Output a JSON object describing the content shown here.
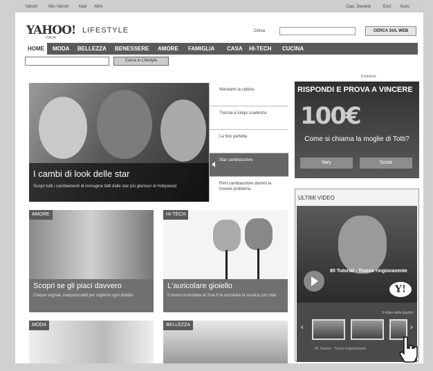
{
  "topbar": {
    "links": [
      "Yahoo!",
      "Mio Yahoo!",
      "Mail",
      "Altro"
    ],
    "user_links": [
      "Ciao, Daniela",
      "Esci",
      "Aiuto"
    ]
  },
  "header": {
    "logo": "YAHOO!",
    "logo_sub": "ITALIA",
    "section": "LIFESTYLE",
    "search_label": "Cerca",
    "search_value": "",
    "search_button": "CERCA SUL WEB"
  },
  "nav": {
    "items": [
      "HOME",
      "MODA",
      "BELLEZZA",
      "BENESSERE",
      "AMORE",
      "FAMIGLIA",
      "CASA",
      "HI-TECH",
      "CUCINA"
    ]
  },
  "subnav": {
    "search_button": "Cerca in Lifestyle"
  },
  "hero": {
    "title": "I cambi di look delle star",
    "desc": "Scopri tutti i cambiamenti di immagine fatti dalle star più glamour di Hollywood",
    "list": [
      "Mandami la cattiva",
      "Treccia a lunga scadenza",
      "La foto perfetta",
      "Star cambiacolore",
      "Rimi cambiacolore dammi la trovare problema"
    ]
  },
  "cards": [
    {
      "tag": "AMORE",
      "title": "Scopri se gli piaci davvero",
      "desc": "Cinque segnali, inequivocabili per togliersi ogni dubbio"
    },
    {
      "tag": "HI-TECH",
      "title": "L'auricolare gioiello",
      "desc": "Il nuovo Auricolare di 2me ti fa ascoltare la musica con stile"
    },
    {
      "tag": "MODA",
      "title": "",
      "desc": ""
    },
    {
      "tag": "BELLEZZA",
      "title": "",
      "desc": ""
    }
  ],
  "ad": {
    "label": "Pubblicità",
    "headline": "RISPONDI E PROVA A VINCERE",
    "amount": "100€",
    "question": "Come si chiama la moglie di Totti?",
    "options": [
      "Ilary",
      "Sonia"
    ]
  },
  "videos": {
    "heading": "ULTIMI VIDEO",
    "title": "85 Tutorial - Trucco ringiovanente",
    "count": "5 video nella playlist",
    "now_playing": "85 Tutorial - Trucco ringiovanente"
  }
}
